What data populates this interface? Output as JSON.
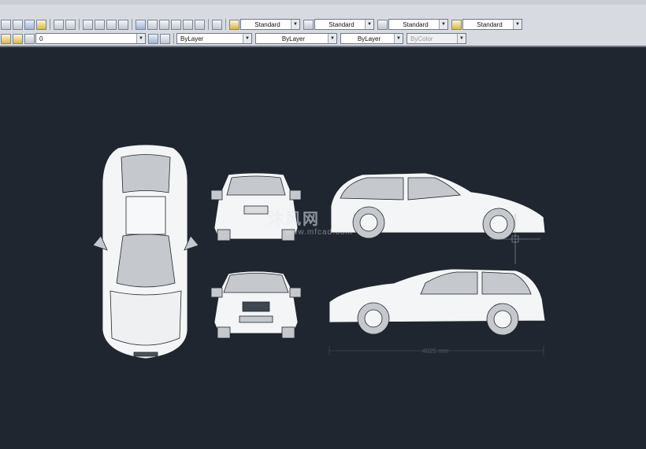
{
  "toolbar_styles": {
    "text_style": "Standard",
    "dim_style": "Standard",
    "table_style": "Standard",
    "multileader_style": "Standard"
  },
  "layers": {
    "current_layer": "0",
    "color": "ByLayer",
    "linetype": "ByLayer",
    "lineweight": "ByLayer",
    "plot_style": "ByColor"
  },
  "drawing": {
    "dimension_label": "4025 mm",
    "watermark_main": "沐风网",
    "watermark_url": "www.mfcad.com"
  },
  "colors": {
    "canvas": "#1f2630",
    "toolbar": "#d7dbe1"
  }
}
